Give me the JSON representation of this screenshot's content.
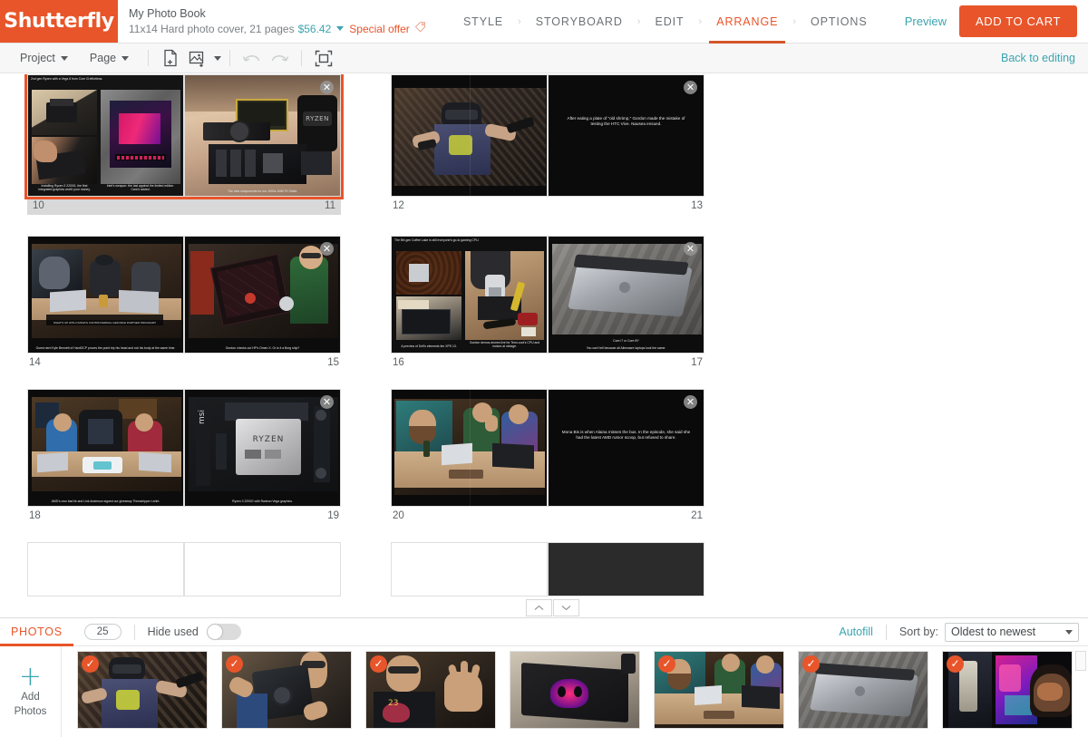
{
  "brand": {
    "name": "Shutterfly",
    "logo_bg": "#e8552a"
  },
  "project": {
    "title": "My Photo Book",
    "spec": "11x14 Hard photo cover, 21 pages",
    "price": "$56.42",
    "special_offer": "Special offer",
    "tag_icon": "tag-icon"
  },
  "nav": {
    "tabs": [
      {
        "label": "STYLE",
        "active": false
      },
      {
        "label": "STORYBOARD",
        "active": false
      },
      {
        "label": "EDIT",
        "active": false
      },
      {
        "label": "ARRANGE",
        "active": true
      },
      {
        "label": "OPTIONS",
        "active": false
      }
    ],
    "separator": "›",
    "preview": "Preview",
    "add_to_cart": "ADD TO CART",
    "accent": "#e8552a"
  },
  "toolbar": {
    "project_menu": "Project",
    "page_menu": "Page",
    "add_page_icon": "add-page-icon",
    "add_photo_icon": "add-photo-icon",
    "undo_icon": "undo-icon",
    "redo_icon": "redo-icon",
    "fullscreen_icon": "fullscreen-icon",
    "back_to_editing": "Back to editing"
  },
  "canvas": {
    "rows": [
      {
        "spreads": [
          {
            "left_page": "10",
            "right_page": "11",
            "selected": true,
            "left_caption_top": "2nd gen Ryzen with a Vega 8 from Core i3 effortless.",
            "left_caption_a": "Installing Ryzen 3 2200G, the first integrated graphics worth your money.",
            "left_caption_b": "Intel's weapon: the last against the limited edition. Cant it added.",
            "right_caption": "The new components for our 1900s 1080 PC Build."
          },
          {
            "left_page": "12",
            "right_page": "13",
            "selected": false,
            "right_caption": "After eating a plate of \"old shrimp,\" Gordon made the mistake of testing the HTC Vive. Nausea ensued."
          }
        ]
      },
      {
        "spreads": [
          {
            "left_page": "14",
            "right_page": "15",
            "selected": false,
            "left_banner": "WHAT'S UP WITH NVIDIA'S CONTROVERSIAL GEFORCE PARTNER PROGRAM?",
            "left_caption": "Guest nerd Kyle Bennett of HardOCP proves the point trip his head and rub his body at the same time.",
            "right_caption": "Gordon checks out HP's Omen X. Or is it a Borg ship?"
          },
          {
            "left_page": "16",
            "right_page": "17",
            "selected": false,
            "left_caption_top": "The 5th gen Coffee Lake is still everyone's go-to gaming CPU.",
            "left_caption_a": "A preview of Dell's elements tier XPS 13.",
            "left_caption_b": "Gordon demos drones live for Tenn-cool's CPU and motors at vintage.",
            "right_caption_a": "Core i7 or Core i9?",
            "right_caption_b": "You can't tell because all Alienware laptops look the same."
          }
        ]
      },
      {
        "spreads": [
          {
            "left_page": "18",
            "right_page": "19",
            "selected": false,
            "left_caption": "AMD's own bad lie and Link Anderson signed our giveaway Threadripper t-shirt.",
            "right_caption": "Ryzen 3 2200G with Radeon Vega graphics."
          },
          {
            "left_page": "20",
            "right_page": "21",
            "selected": false,
            "right_caption": "Mona Bis is when Alaina misses the bus. In the episode, she said she had the latest AMD rumor scoop, but refused to share."
          }
        ]
      }
    ]
  },
  "tray": {
    "tab_label": "PHOTOS",
    "count": "25",
    "hide_used_label": "Hide used",
    "hide_used_on": false,
    "autofill": "Autofill",
    "sort_by_label": "Sort by:",
    "sort_value": "Oldest to newest",
    "collapse_up_icon": "chevron-up-icon",
    "collapse_down_icon": "chevron-down-icon",
    "add_photos_line1": "Add",
    "add_photos_line2": "Photos",
    "plus_icon": "plus-icon",
    "used_check": "✓",
    "thumbnails": [
      {
        "name": "vr-headset-photo",
        "used": true
      },
      {
        "name": "graphics-card-photo",
        "used": true
      },
      {
        "name": "hands-gesture-photo",
        "used": true
      },
      {
        "name": "skull-laptop-photo",
        "used": false
      },
      {
        "name": "podcast-desk-photo",
        "used": true
      },
      {
        "name": "silver-laptop-photo",
        "used": true
      },
      {
        "name": "neon-display-photo",
        "used": true
      }
    ]
  }
}
